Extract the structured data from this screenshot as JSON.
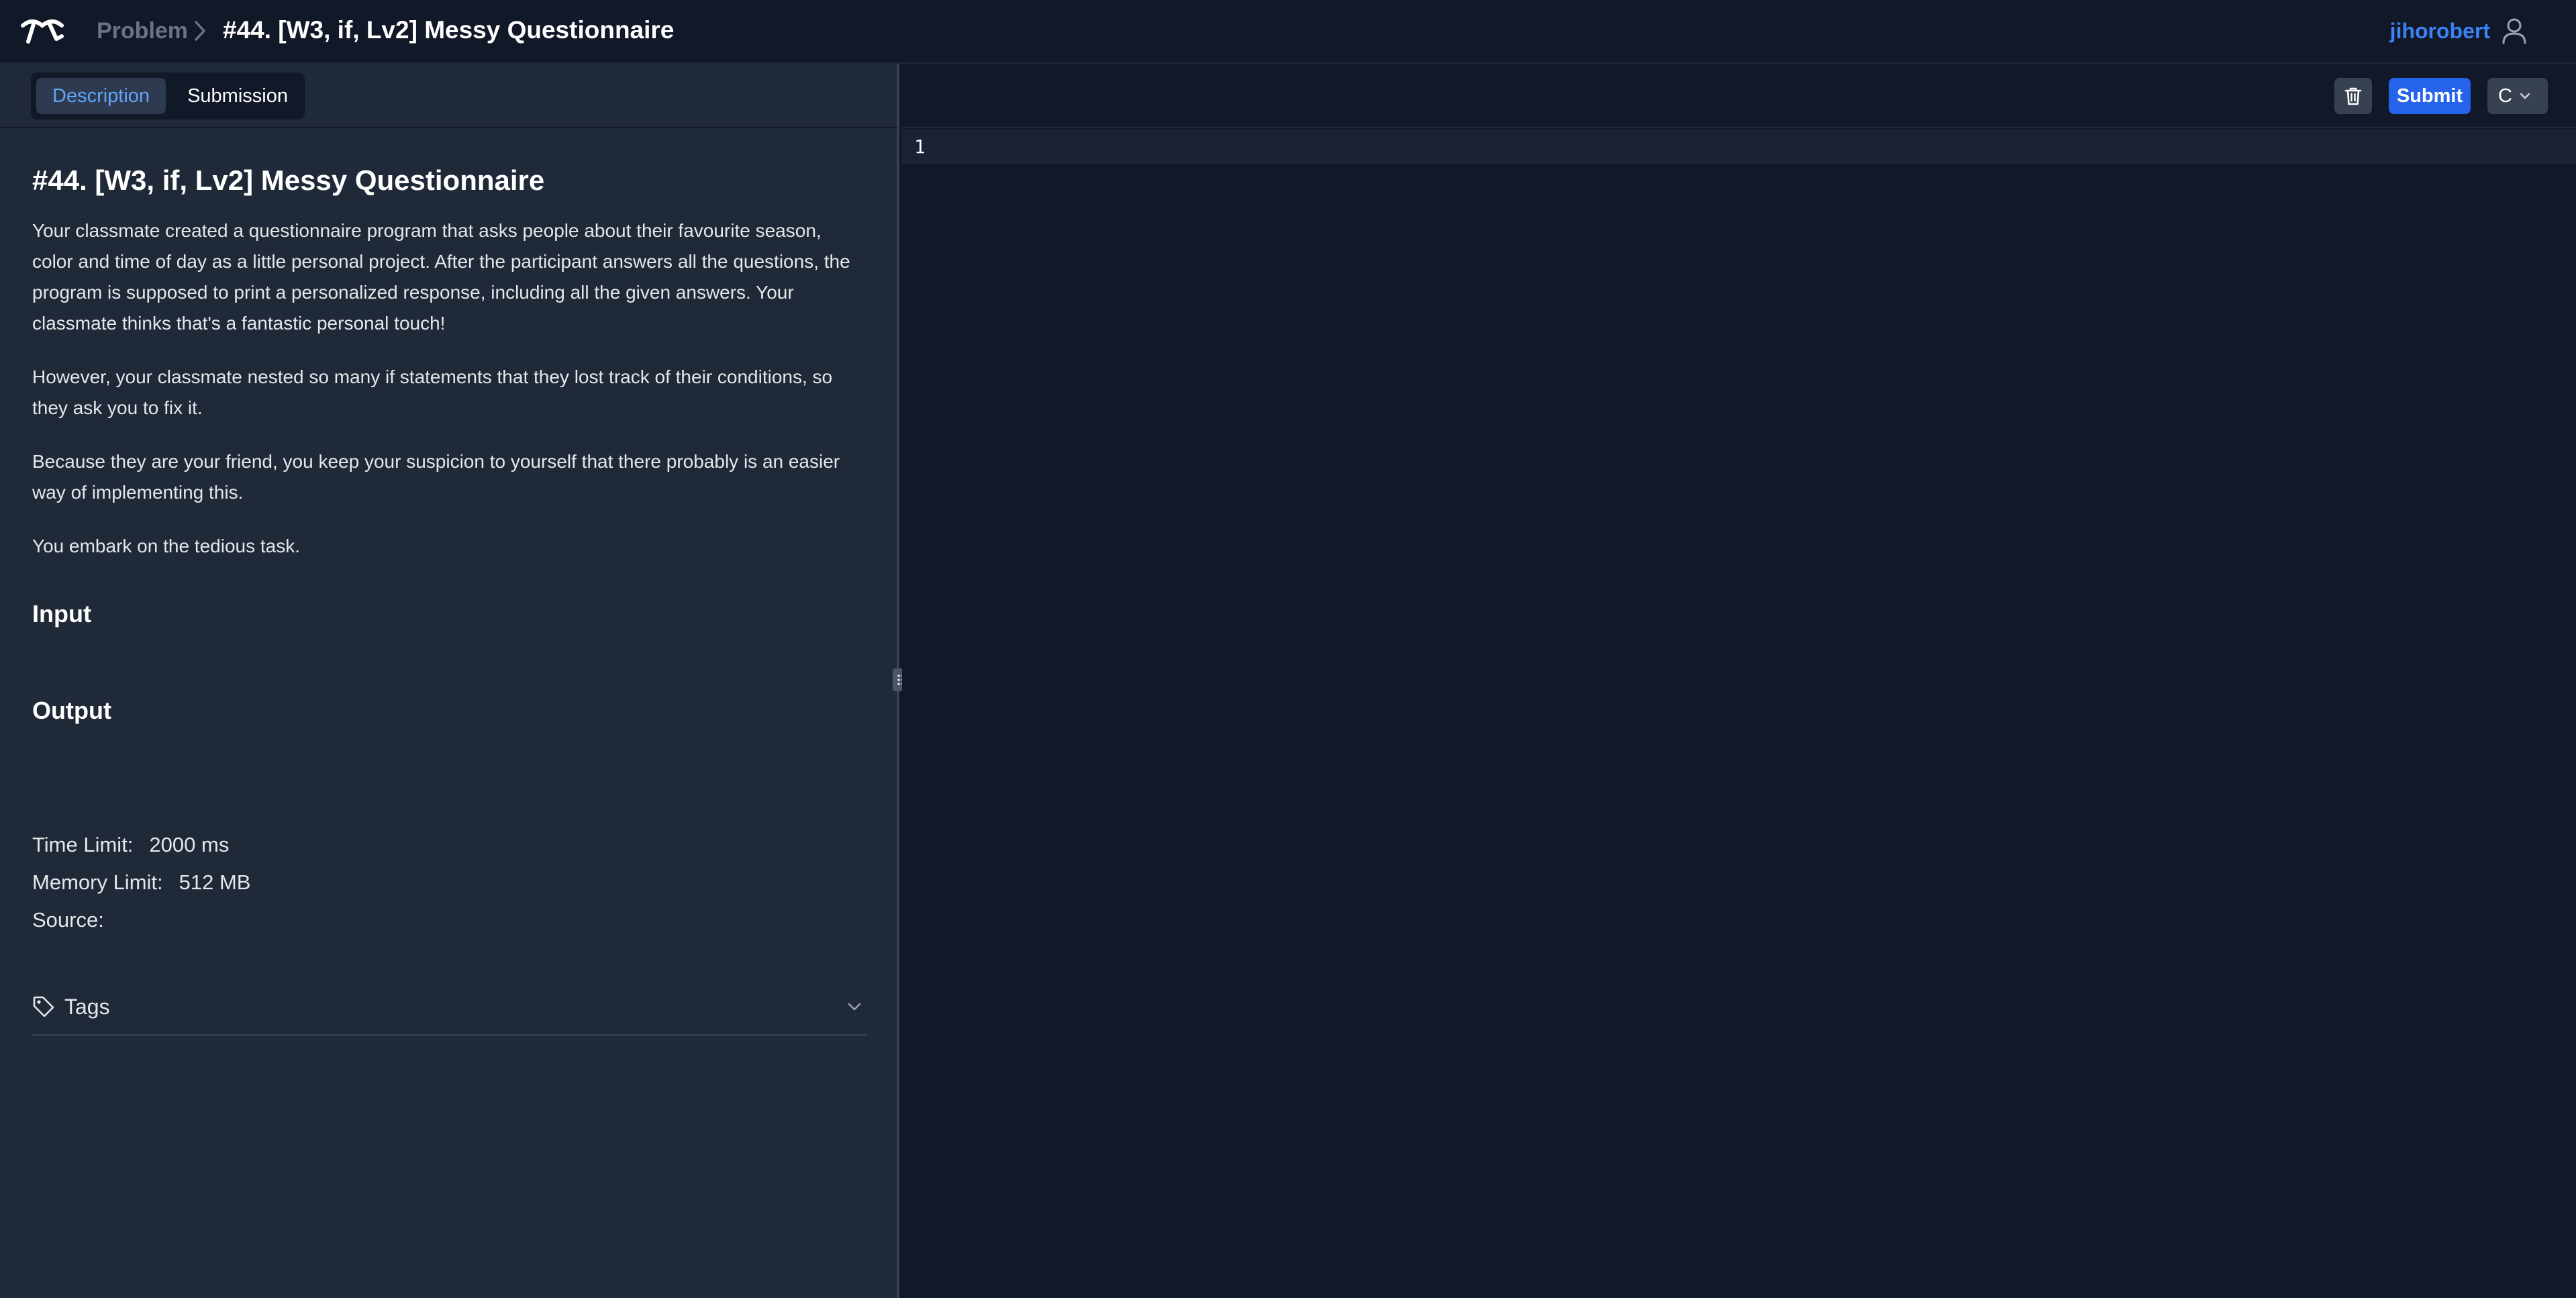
{
  "header": {
    "logo_icon": "logo-icon",
    "breadcrumb_root": "Problem",
    "breadcrumb_title": "#44. [W3, if, Lv2] Messy Questionnaire",
    "username": "jihorobert",
    "user_icon": "user-icon"
  },
  "tabs": {
    "description": "Description",
    "submission": "Submission",
    "active": "Description"
  },
  "problem": {
    "title": "#44. [W3, if, Lv2] Messy Questionnaire",
    "paragraphs": [
      "Your classmate created a questionnaire program that asks people about their favourite season, color and time of day as a little personal project. After the participant answers all the questions, the program is supposed to print a personalized response, including all the given answers. Your classmate thinks that's a fantastic personal touch!",
      "However, your classmate nested so many if statements that they lost track of their conditions, so they ask you to fix it.",
      "Because they are your friend, you keep your suspicion to yourself that there probably is an easier way of implementing this.",
      "You embark on the tedious task."
    ],
    "input_heading": "Input",
    "output_heading": "Output",
    "time_limit_label": "Time Limit:",
    "time_limit_value": "2000 ms",
    "memory_limit_label": "Memory Limit:",
    "memory_limit_value": "512 MB",
    "source_label": "Source:",
    "source_value": "",
    "tags_label": "Tags"
  },
  "editor": {
    "submit_label": "Submit",
    "language": "C",
    "line_numbers": [
      "1"
    ]
  },
  "colors": {
    "accent": "#3b82f6",
    "submit": "#2563eb",
    "background": "#111827",
    "panel": "#1f2937"
  }
}
